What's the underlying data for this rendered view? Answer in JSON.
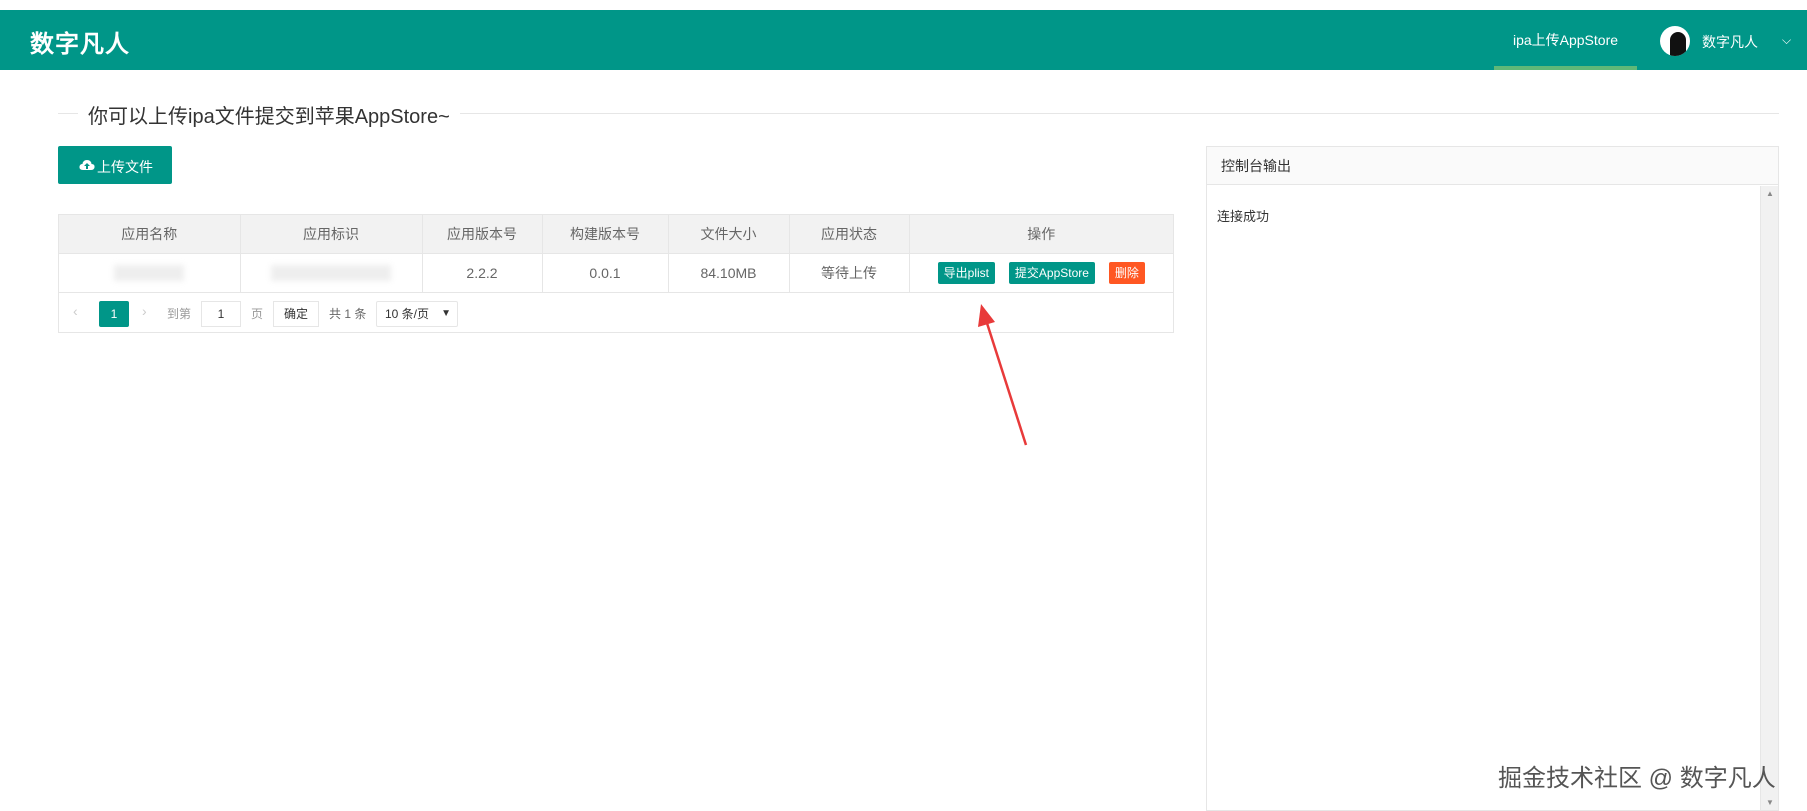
{
  "header": {
    "logo": "数字凡人",
    "nav_item": "ipa上传AppStore",
    "user_name": "数字凡人",
    "accent_color": "#009688"
  },
  "main": {
    "section_title": "你可以上传ipa文件提交到苹果AppStore~",
    "upload_button": "上传文件"
  },
  "table": {
    "columns": [
      "应用名称",
      "应用标识",
      "应用版本号",
      "构建版本号",
      "文件大小",
      "应用状态",
      "操作"
    ],
    "rows": [
      {
        "version": "2.2.2",
        "build": "0.0.1",
        "size": "84.10MB",
        "status": "等待上传",
        "actions": [
          "导出plist",
          "提交AppStore",
          "删除"
        ]
      }
    ]
  },
  "pager": {
    "current_page": "1",
    "goto_label": "到第",
    "goto_value": "1",
    "page_label": "页",
    "confirm": "确定",
    "total": "共 1 条",
    "page_size": "10 条/页"
  },
  "console": {
    "title": "控制台输出",
    "log": "连接成功"
  },
  "watermark": "掘金技术社区 @ 数字凡人"
}
